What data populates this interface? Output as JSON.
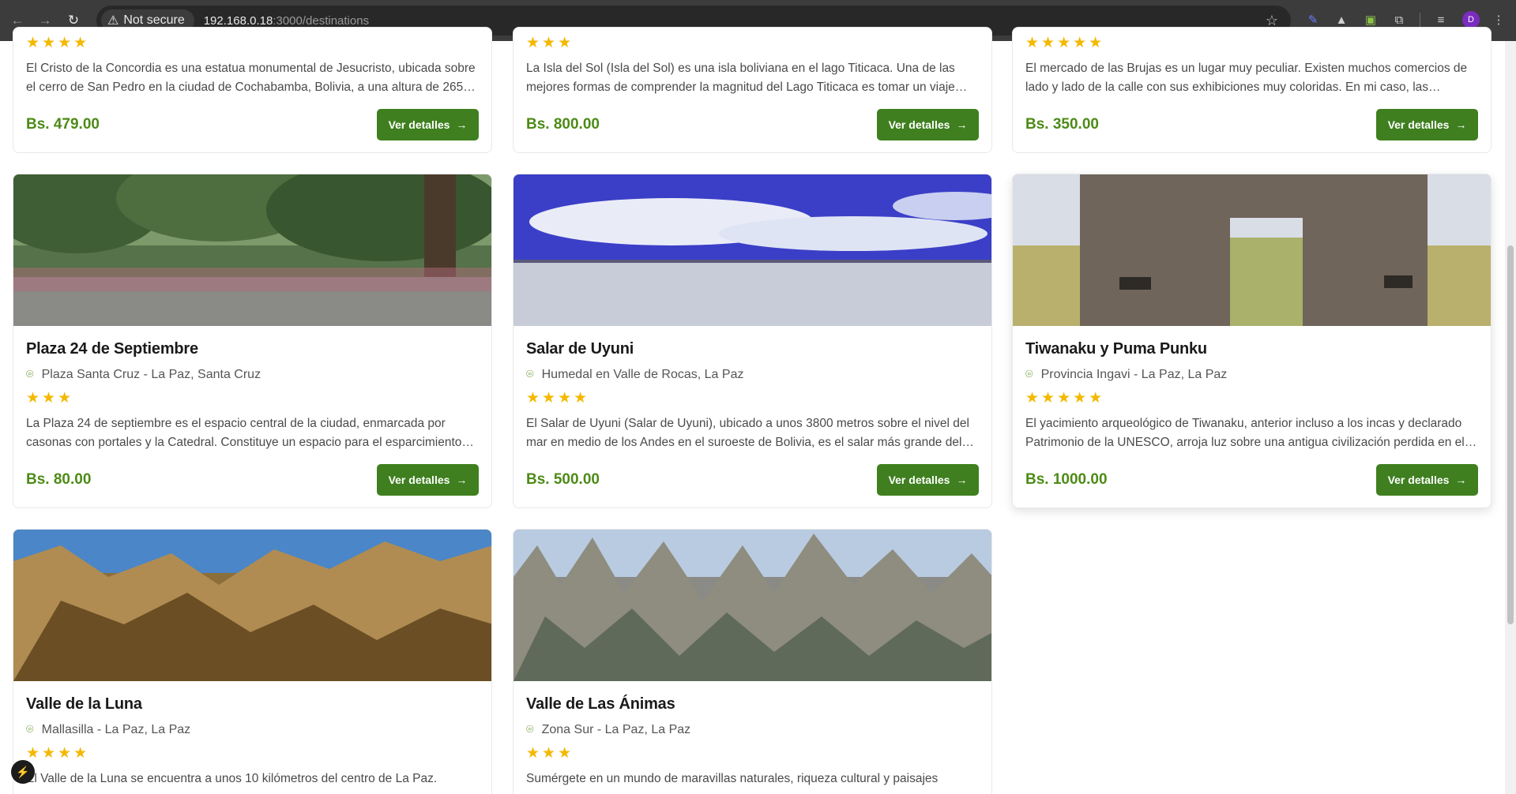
{
  "browser": {
    "security_label": "Not secure",
    "url_host": "192.168.0.18",
    "url_path": ":3000/destinations",
    "profile_initial": "D"
  },
  "top_row": [
    {
      "stars": "★★★★",
      "desc": "El Cristo de la Concordia es una estatua monumental de Jesucristo, ubicada sobre el cerro de San Pedro en la ciudad de Cochabamba, Bolivia, a una altura de 265…",
      "price": "Bs. 479.00"
    },
    {
      "stars": "★★★",
      "desc": "La Isla del Sol (Isla del Sol) es una isla boliviana en el lago Titicaca. Una de las mejores formas de comprender la magnitud del Lago Titicaca es tomar un viaje…",
      "price": "Bs. 800.00"
    },
    {
      "stars": "★★★★★",
      "desc": "El mercado de las Brujas es un lugar muy peculiar. Existen muchos comercios de lado y lado de la calle con sus exhibiciones muy coloridas. En mi caso, las…",
      "price": "Bs. 350.00"
    }
  ],
  "mid_row": [
    {
      "title": "Plaza 24 de Septiembre",
      "location": "Plaza Santa Cruz - La Paz, Santa Cruz",
      "stars": "★★★",
      "desc": "La Plaza 24 de septiembre es el espacio central de la ciudad, enmarcada por casonas con portales y la Catedral. Constituye un espacio para el esparcimiento…",
      "price": "Bs. 80.00"
    },
    {
      "title": "Salar de Uyuni",
      "location": "Humedal en Valle de Rocas, La Paz",
      "stars": "★★★★",
      "desc": "El Salar de Uyuni (Salar de Uyuni), ubicado a unos 3800 metros sobre el nivel del mar en medio de los Andes en el suroeste de Bolivia, es el salar más grande del…",
      "price": "Bs. 500.00"
    },
    {
      "title": "Tiwanaku y Puma Punku",
      "location": "Provincia Ingavi - La Paz, La Paz",
      "stars": "★★★★★",
      "desc": "El yacimiento arqueológico de Tiwanaku, anterior incluso a los incas y declarado Patrimonio de la UNESCO, arroja luz sobre una antigua civilización perdida en el…",
      "price": "Bs. 1000.00"
    }
  ],
  "bottom_row": [
    {
      "title": "Valle de la Luna",
      "location": "Mallasilla - La Paz, La Paz",
      "stars": "★★★★",
      "desc": "El Valle de la Luna se encuentra a unos 10 kilómetros del centro de La Paz."
    },
    {
      "title": "Valle de Las Ánimas",
      "location": "Zona Sur - La Paz, La Paz",
      "stars": "★★★",
      "desc": "Sumérgete en un mundo de maravillas naturales, riqueza cultural y paisajes"
    }
  ],
  "button_label": "Ver detalles",
  "colors": {
    "price": "#4d8b16",
    "button": "#3f7f1f",
    "stars": "#f4b800"
  }
}
